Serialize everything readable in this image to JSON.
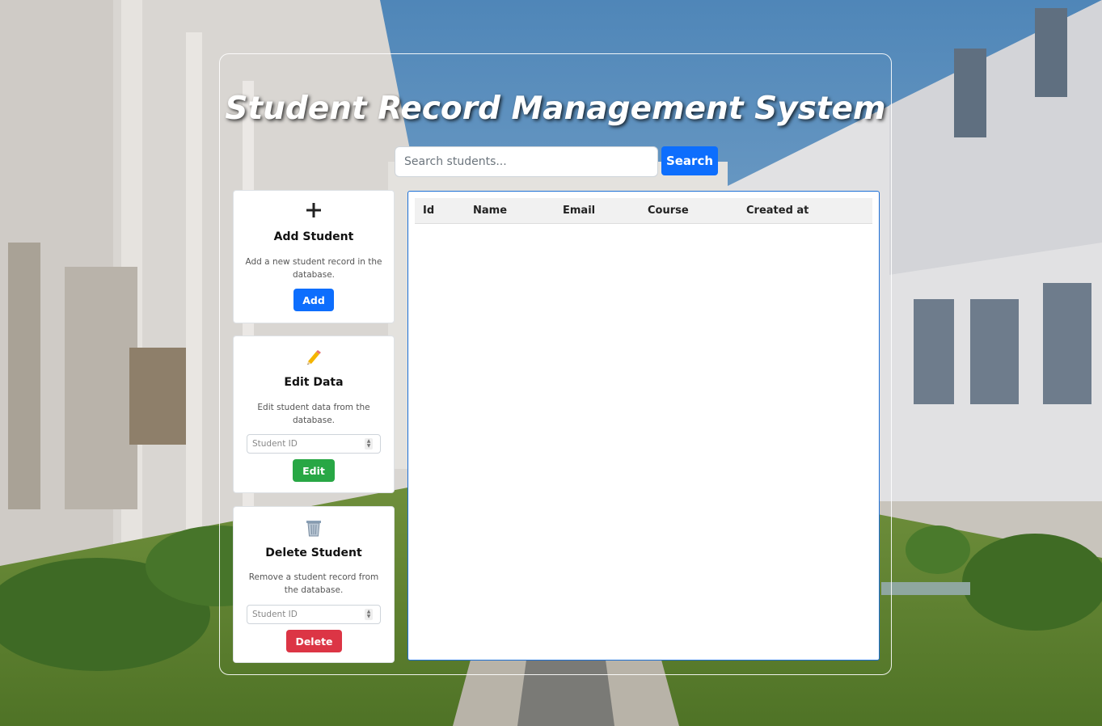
{
  "header": {
    "title": "Student Record Management System"
  },
  "search": {
    "placeholder": "Search students...",
    "value": "",
    "button_label": "Search"
  },
  "cards": {
    "add": {
      "icon": "plus-icon",
      "title": "Add Student",
      "description": "Add a new student record in the database.",
      "button_label": "Add"
    },
    "edit": {
      "icon": "pencil-icon",
      "title": "Edit Data",
      "description": "Edit student data from the database.",
      "input_placeholder": "Student ID",
      "button_label": "Edit"
    },
    "delete": {
      "icon": "trash-icon",
      "title": "Delete Student",
      "description": "Remove a student record from the database.",
      "input_placeholder": "Student ID",
      "button_label": "Delete"
    }
  },
  "table": {
    "columns": [
      "Id",
      "Name",
      "Email",
      "Course",
      "Created at"
    ],
    "rows": []
  },
  "colors": {
    "primary": "#0d6efd",
    "success": "#28a745",
    "danger": "#dc3545",
    "table_border": "#1c6fd6"
  }
}
